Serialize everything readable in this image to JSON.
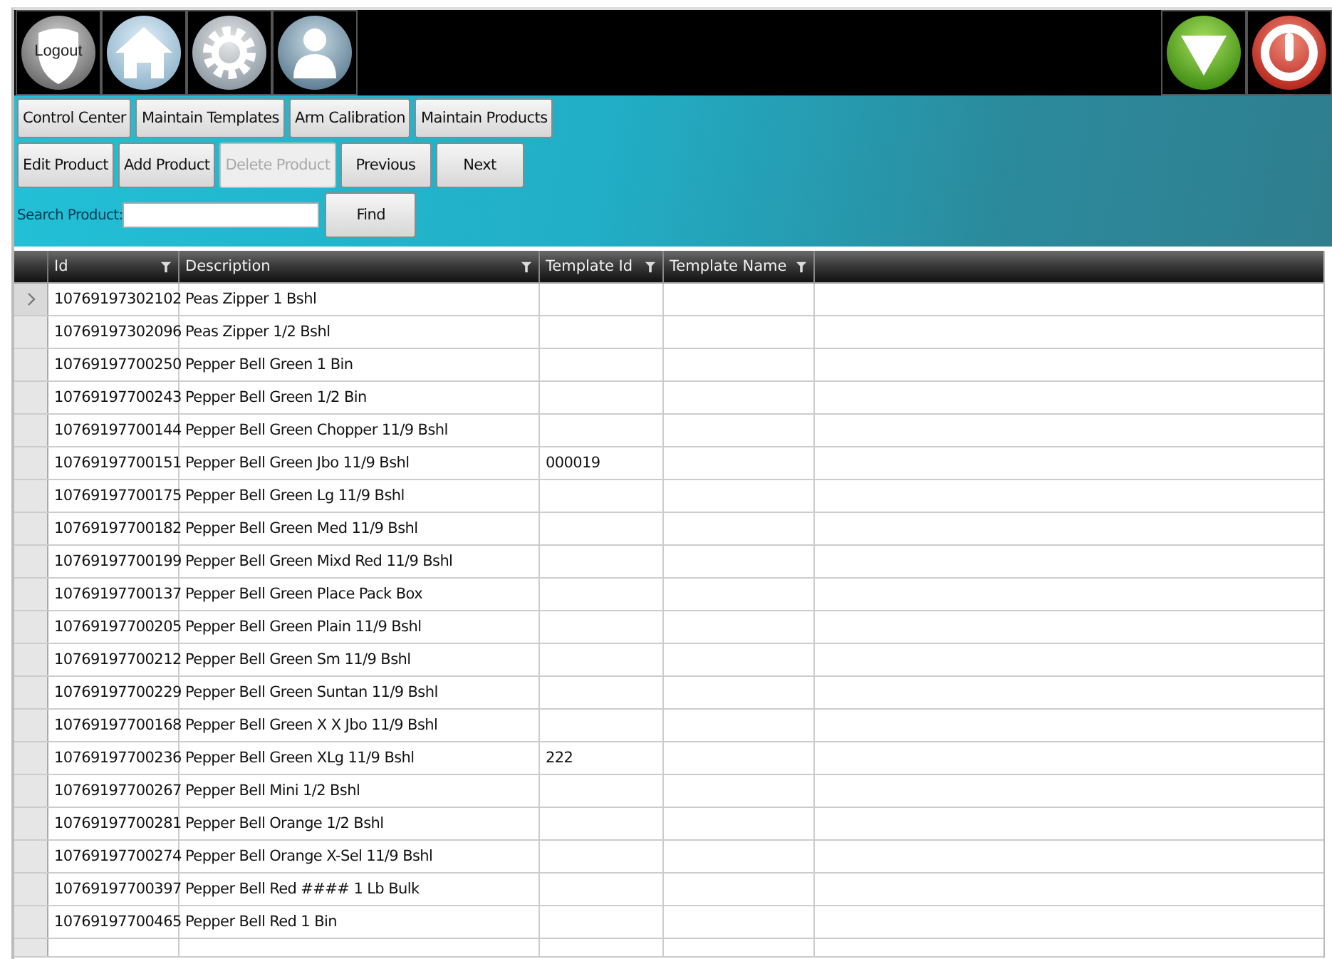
{
  "toolbar": {
    "logout_label": "Logout"
  },
  "nav_buttons": [
    {
      "label": "Control Center"
    },
    {
      "label": "Maintain Templates"
    },
    {
      "label": "Arm Calibration"
    },
    {
      "label": "Maintain Products"
    }
  ],
  "action_buttons": [
    {
      "label": "Edit Product",
      "disabled": false
    },
    {
      "label": "Add Product",
      "disabled": false
    },
    {
      "label": "Delete Product",
      "disabled": true
    },
    {
      "label": "Previous",
      "disabled": false
    },
    {
      "label": "Next",
      "disabled": false
    }
  ],
  "search": {
    "label": "Search Product:",
    "button": "Find"
  },
  "table": {
    "columns": [
      "Id",
      "Description",
      "Template Id",
      "Template Name"
    ],
    "rows": [
      {
        "selected": true,
        "cells": [
          "10769197302102",
          "Peas Zipper 1 Bshl",
          "",
          ""
        ]
      },
      {
        "selected": false,
        "cells": [
          "10769197302096",
          "Peas Zipper 1/2 Bshl",
          "",
          ""
        ]
      },
      {
        "selected": false,
        "cells": [
          "10769197700250",
          "Pepper Bell Green 1 Bin",
          "",
          ""
        ]
      },
      {
        "selected": false,
        "cells": [
          "10769197700243",
          "Pepper Bell Green 1/2 Bin",
          "",
          ""
        ]
      },
      {
        "selected": false,
        "cells": [
          "10769197700144",
          "Pepper Bell Green Chopper 11/9 Bshl",
          "",
          ""
        ]
      },
      {
        "selected": false,
        "cells": [
          "10769197700151",
          "Pepper Bell Green Jbo 11/9 Bshl",
          "000019",
          ""
        ]
      },
      {
        "selected": false,
        "cells": [
          "10769197700175",
          "Pepper Bell Green Lg 11/9 Bshl",
          "",
          ""
        ]
      },
      {
        "selected": false,
        "cells": [
          "10769197700182",
          "Pepper Bell Green Med 11/9 Bshl",
          "",
          ""
        ]
      },
      {
        "selected": false,
        "cells": [
          "10769197700199",
          "Pepper Bell Green Mixd Red 11/9 Bshl",
          "",
          ""
        ]
      },
      {
        "selected": false,
        "cells": [
          "10769197700137",
          "Pepper Bell Green Place Pack Box",
          "",
          ""
        ]
      },
      {
        "selected": false,
        "cells": [
          "10769197700205",
          "Pepper Bell Green Plain 11/9 Bshl",
          "",
          ""
        ]
      },
      {
        "selected": false,
        "cells": [
          "10769197700212",
          "Pepper Bell Green Sm 11/9 Bshl",
          "",
          ""
        ]
      },
      {
        "selected": false,
        "cells": [
          "10769197700229",
          "Pepper Bell Green Suntan 11/9 Bshl",
          "",
          ""
        ]
      },
      {
        "selected": false,
        "cells": [
          "10769197700168",
          "Pepper Bell Green X X Jbo 11/9 Bshl",
          "",
          ""
        ]
      },
      {
        "selected": false,
        "cells": [
          "10769197700236",
          "Pepper Bell Green XLg 11/9 Bshl",
          "222",
          ""
        ]
      },
      {
        "selected": false,
        "cells": [
          "10769197700267",
          "Pepper Bell Mini 1/2 Bshl",
          "",
          ""
        ]
      },
      {
        "selected": false,
        "cells": [
          "10769197700281",
          "Pepper Bell Orange 1/2 Bshl",
          "",
          ""
        ]
      },
      {
        "selected": false,
        "cells": [
          "10769197700274",
          "Pepper Bell Orange X-Sel 11/9 Bshl",
          "",
          ""
        ]
      },
      {
        "selected": false,
        "cells": [
          "10769197700397",
          "Pepper Bell Red #### 1 Lb Bulk",
          "",
          ""
        ]
      },
      {
        "selected": false,
        "cells": [
          "10769197700465",
          "Pepper Bell Red 1 Bin",
          "",
          ""
        ]
      }
    ]
  }
}
